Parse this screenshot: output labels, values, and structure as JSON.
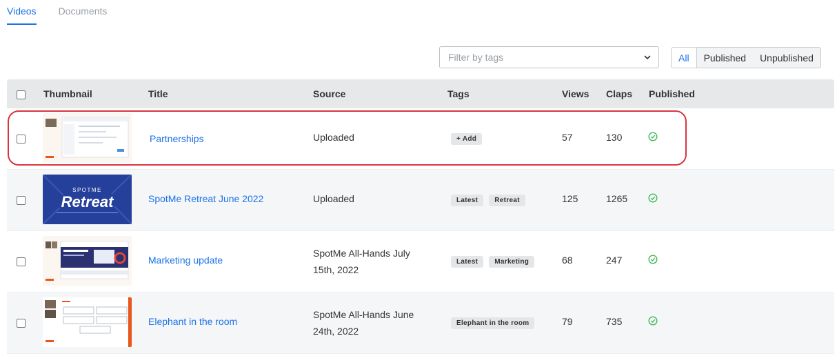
{
  "tabs": [
    {
      "label": "Videos",
      "active": true
    },
    {
      "label": "Documents",
      "active": false
    }
  ],
  "filter": {
    "placeholder": "Filter by tags"
  },
  "publish_filter": {
    "options": [
      "All",
      "Published",
      "Unpublished"
    ],
    "selected": "All"
  },
  "table": {
    "headers": {
      "thumbnail": "Thumbnail",
      "title": "Title",
      "source": "Source",
      "tags": "Tags",
      "views": "Views",
      "claps": "Claps",
      "published": "Published"
    },
    "rows": [
      {
        "title": "Partnerships",
        "source": "Uploaded",
        "tags": [],
        "add_tag_label": "+ Add",
        "views": "57",
        "claps": "130",
        "published": true
      },
      {
        "title": "SpotMe Retreat June 2022",
        "source": "Uploaded",
        "tags": [
          "Latest",
          "Retreat"
        ],
        "views": "125",
        "claps": "1265",
        "published": true,
        "thumbnail_text": {
          "brand": "SPOTME",
          "headline": "Retreat"
        }
      },
      {
        "title": "Marketing update",
        "source_lines": [
          "SpotMe All-Hands July",
          "15th, 2022"
        ],
        "tags": [
          "Latest",
          "Marketing"
        ],
        "views": "68",
        "claps": "247",
        "published": true
      },
      {
        "title": "Elephant in the room",
        "source_lines": [
          "SpotMe All-Hands June",
          "24th, 2022"
        ],
        "tags": [
          "Elephant in the room"
        ],
        "views": "79",
        "claps": "735",
        "published": true
      }
    ]
  },
  "colors": {
    "accent": "#1a73e8",
    "published_check": "#3cba54",
    "highlight": "#d9333f",
    "header_bg": "#e6e8ea"
  }
}
